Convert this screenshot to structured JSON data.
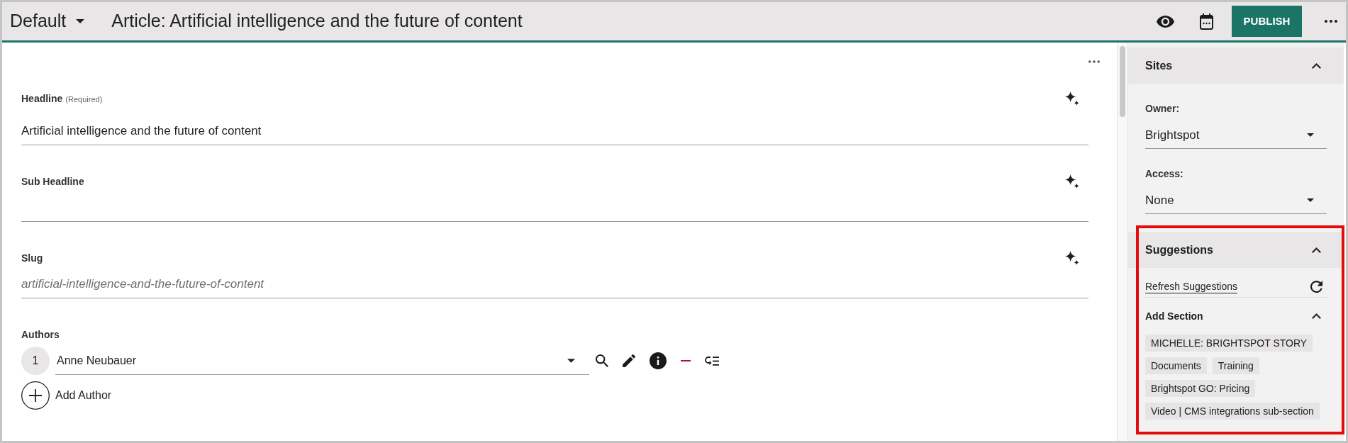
{
  "top_bar": {
    "view_selector": "Default",
    "title": "Article: Artificial intelligence and the future of content",
    "publish_button": "PUBLISH"
  },
  "form": {
    "fields": [
      {
        "label": "Headline",
        "note": "(Required)",
        "value": "Artificial intelligence and the future of content"
      },
      {
        "label": "Sub Headline"
      },
      {
        "label": "Slug",
        "placeholder": "artificial-intelligence-and-the-future-of-content"
      }
    ],
    "authors": {
      "label": "Authors",
      "items": [
        {
          "number": "1",
          "name": "Anne Neubauer"
        }
      ],
      "add_button": "Add Author"
    }
  },
  "sidebar": {
    "sites": {
      "title": "Sites",
      "expanded": true,
      "fields": [
        {
          "label": "Owner:",
          "value": "Brightspot"
        },
        {
          "label": "Access:",
          "value": "None"
        }
      ]
    },
    "suggestions": {
      "title": "Suggestions",
      "expanded": true,
      "highlighted": true,
      "refresh_link": "Refresh Suggestions",
      "add_section": {
        "title": "Add Section",
        "expanded": true,
        "tags": [
          "MICHELLE: BRIGHTSPOT STORY",
          "Documents",
          "Training",
          "Brightspot GO: Pricing",
          "Video | CMS integrations sub-section"
        ]
      }
    }
  }
}
